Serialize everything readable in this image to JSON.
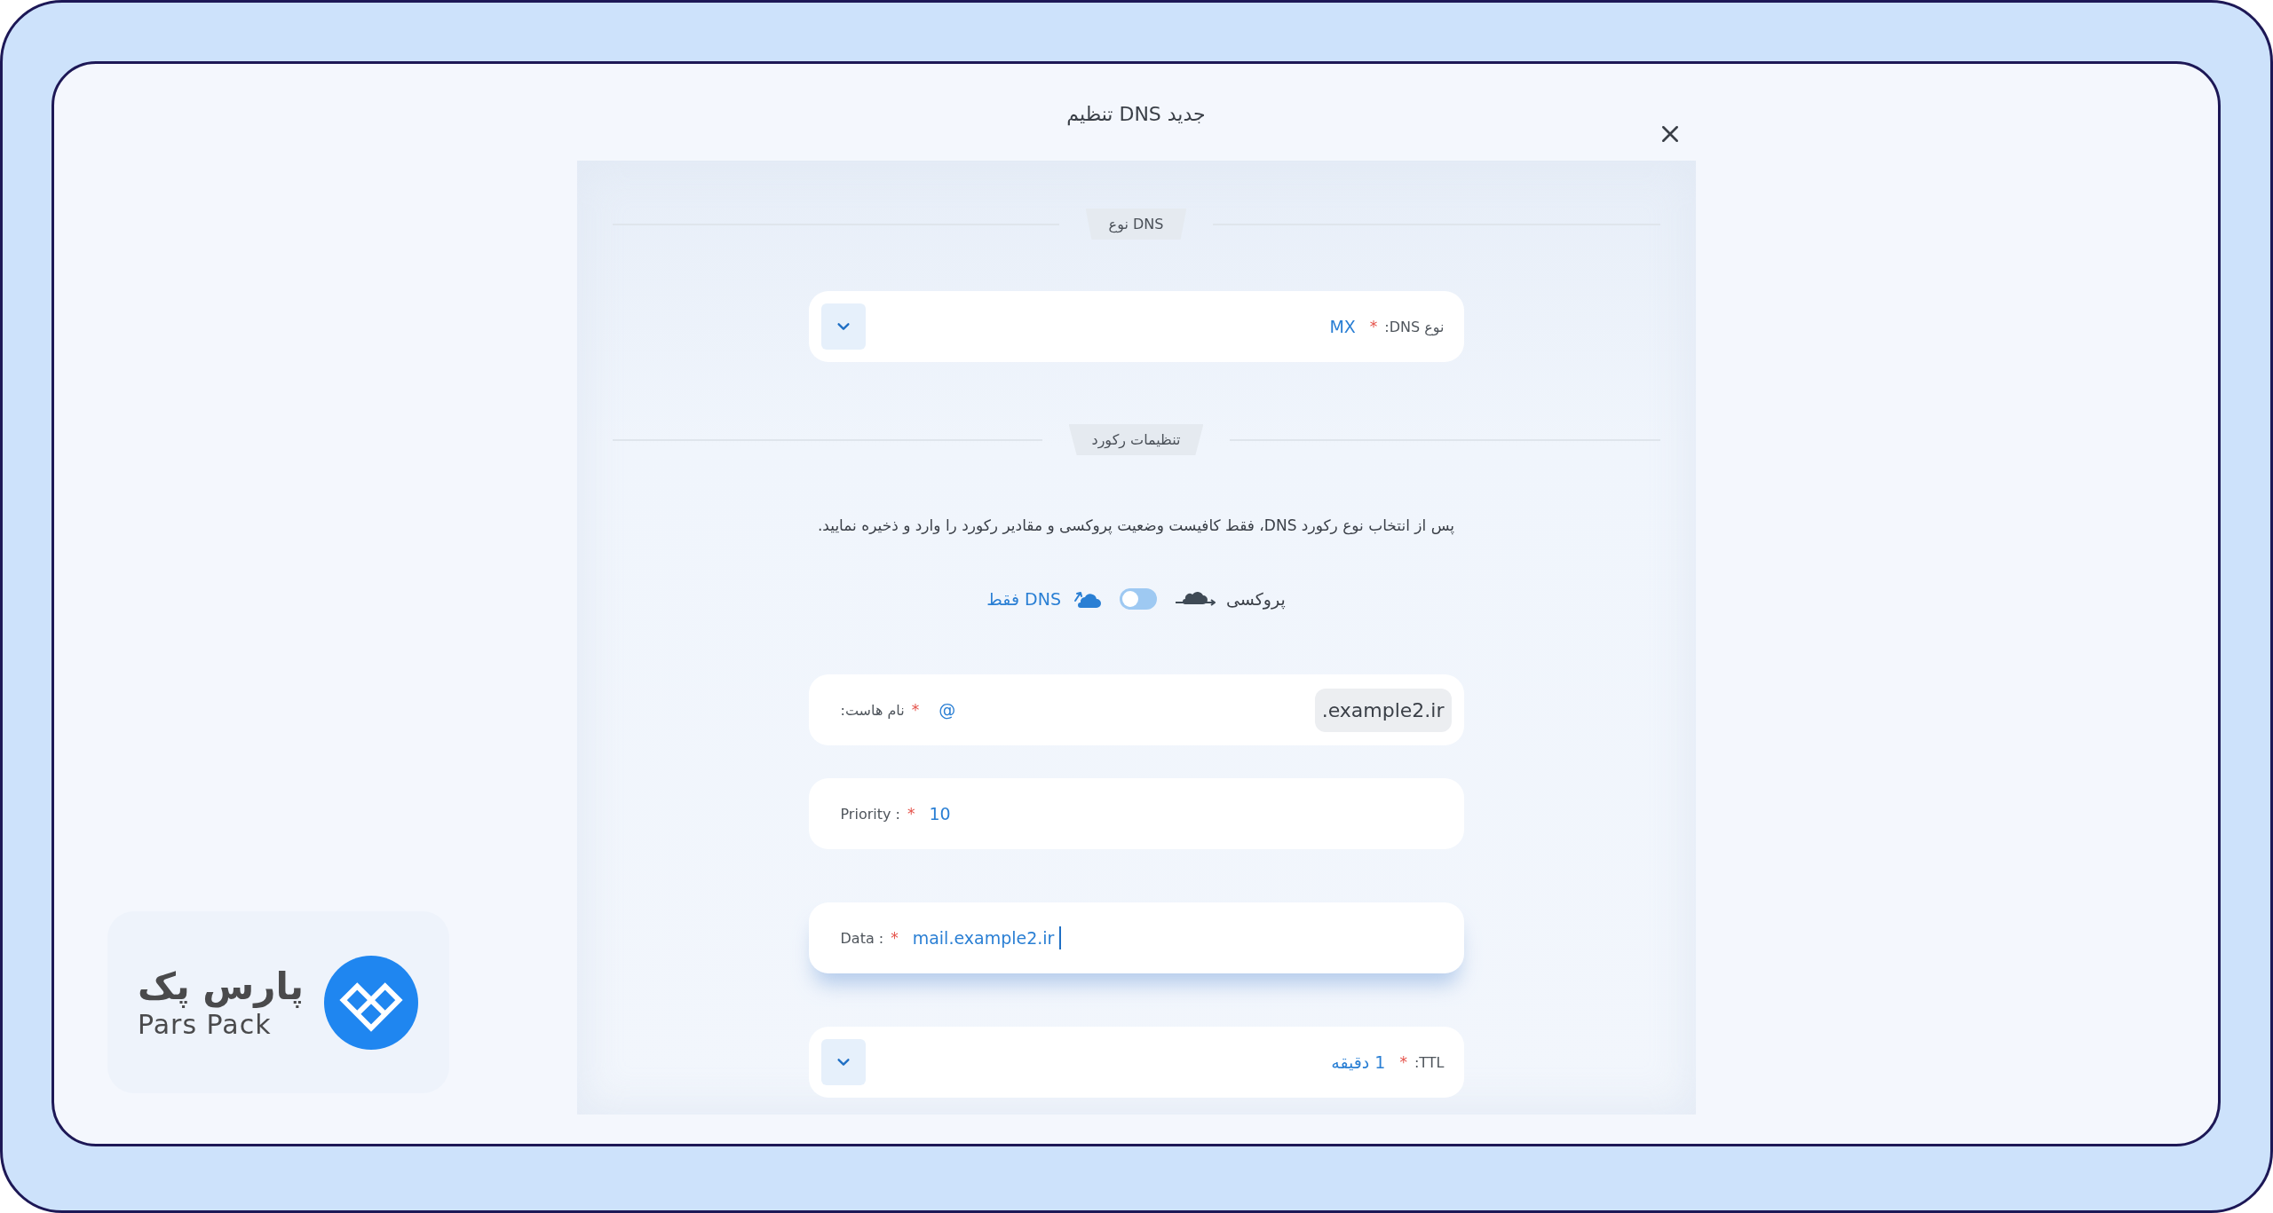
{
  "dialog": {
    "title": "تنظیم DNS جدید"
  },
  "dns_type_section": {
    "label": "نوع DNS",
    "fields": [
      {
        "kind": "select",
        "label": "نوع DNS:",
        "required_mark": "*",
        "value": "MX"
      }
    ]
  },
  "record_section": {
    "label": "تنظیمات رکورد",
    "description": "پس از انتخاب نوع رکورد DNS، فقط کافیست وضعیت پروکسی و مقادیر رکورد را وارد و ذخیره نمایید.",
    "proxy_toggle": {
      "on_label": "پروکسی",
      "off_label": "فقط DNS",
      "on": false
    },
    "fields": [
      {
        "kind": "host",
        "label": "نام هاست:",
        "required_mark": "*",
        "value": "@",
        "suffix": ".example2.ir"
      },
      {
        "kind": "text",
        "label": "Priority :",
        "required_mark": "*",
        "value": "10",
        "focused": false
      },
      {
        "kind": "text",
        "label": "Data :",
        "required_mark": "*",
        "value": "mail.example2.ir",
        "focused": true
      },
      {
        "kind": "select",
        "label": "TTL:",
        "required_mark": "*",
        "value": "1 دقیقه"
      }
    ]
  },
  "brand": {
    "name_fa": "پارس پک",
    "name_en": "Pars Pack"
  }
}
